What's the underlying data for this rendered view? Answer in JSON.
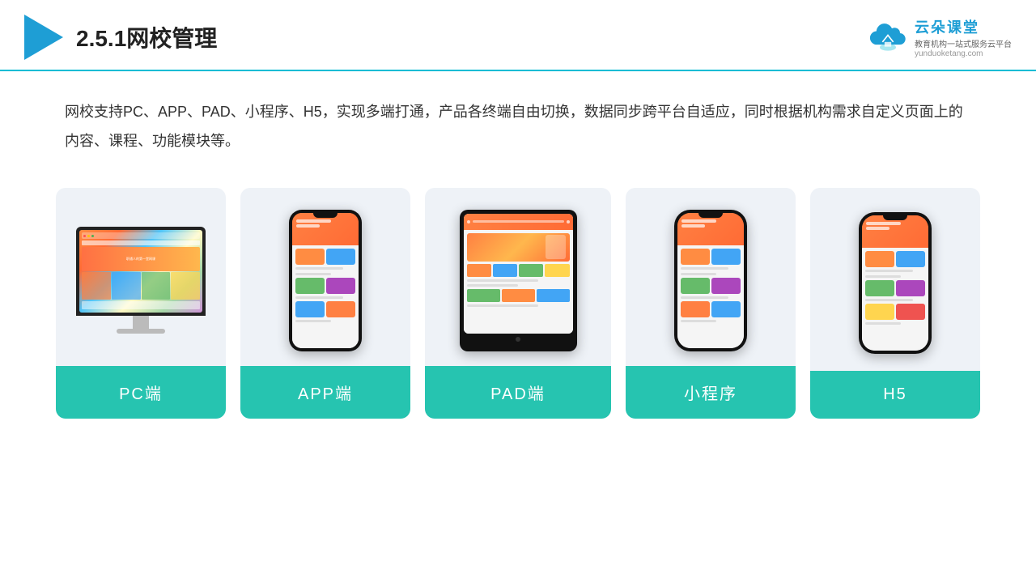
{
  "header": {
    "section_number": "2.5.1",
    "title": "网校管理",
    "brand": {
      "name": "云朵课堂",
      "tagline": "教育机构一站式服务云平台",
      "url": "yunduoketang.com"
    }
  },
  "description": {
    "text": "网校支持PC、APP、PAD、小程序、H5，实现多端打通，产品各终端自由切换，数据同步跨平台自适应，同时根据机构需求自定义页面上的内容、课程、功能模块等。"
  },
  "cards": [
    {
      "id": "pc",
      "label": "PC端",
      "type": "pc"
    },
    {
      "id": "app",
      "label": "APP端",
      "type": "phone"
    },
    {
      "id": "pad",
      "label": "PAD端",
      "type": "tablet"
    },
    {
      "id": "miniprogram",
      "label": "小程序",
      "type": "phone"
    },
    {
      "id": "h5",
      "label": "H5",
      "type": "phone"
    }
  ],
  "colors": {
    "primary": "#1e9ed5",
    "card_label_bg": "#26c4b0",
    "header_border": "#00bcd4",
    "text_main": "#333",
    "card_bg": "#eef2f7"
  }
}
